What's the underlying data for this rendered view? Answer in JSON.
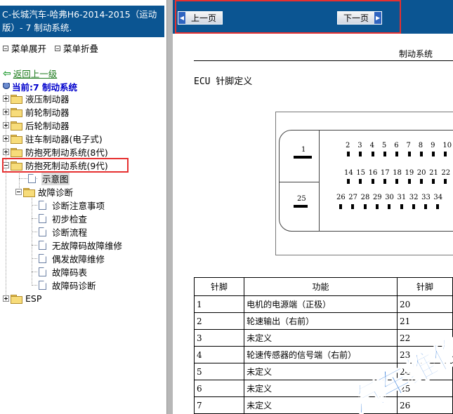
{
  "left_panel": {
    "title": "C-长城汽车-哈弗H6-2014-2015（运动版）- 7 制动系统.",
    "expand_all": "菜单展开",
    "collapse_all": "菜单折叠",
    "back_link": "返回上一级",
    "current": "当前:7 制动系统",
    "tree": [
      {
        "label": "液压制动器",
        "expanded": false
      },
      {
        "label": "前轮制动器",
        "expanded": false
      },
      {
        "label": "后轮制动器",
        "expanded": false
      },
      {
        "label": "驻车制动器(电子式)",
        "expanded": false
      },
      {
        "label": "防抱死制动系统(8代)",
        "expanded": false
      },
      {
        "label": "防抱死制动系统(9代)",
        "expanded": true
      },
      {
        "label": "示意图",
        "selected": true
      },
      {
        "label": "故障诊断",
        "expanded": true
      },
      {
        "label": "诊断注意事项"
      },
      {
        "label": "初步检查"
      },
      {
        "label": "诊断流程"
      },
      {
        "label": "无故障码故障维修"
      },
      {
        "label": "偶发故障维修"
      },
      {
        "label": "故障码表"
      },
      {
        "label": "故障码诊断"
      },
      {
        "label": "ESP",
        "expanded": false
      }
    ]
  },
  "nav": {
    "prev_label": "上一页",
    "next_label": "下一页"
  },
  "document": {
    "section_title": "制动系统",
    "heading": "ECU 针脚定义",
    "connector": {
      "left_pins": [
        "1",
        "25"
      ],
      "row1": [
        "2",
        "3",
        "4",
        "5",
        "6",
        "7",
        "8",
        "9",
        "10"
      ],
      "row2": [
        "14",
        "15",
        "16",
        "17",
        "18",
        "19",
        "20",
        "21",
        "22"
      ],
      "row3": [
        "26",
        "27",
        "28",
        "29",
        "30",
        "31",
        "32",
        "33",
        "34"
      ]
    },
    "table": {
      "headers": [
        "针脚",
        "功能",
        "针脚"
      ],
      "rows": [
        [
          "1",
          "电机的电源端（正极）",
          "20"
        ],
        [
          "2",
          "轮速输出（右前）",
          "21"
        ],
        [
          "3",
          "未定义",
          "22"
        ],
        [
          "4",
          "轮速传感器的信号端（右前）",
          "23"
        ],
        [
          "5",
          "未定义",
          "24"
        ],
        [
          "6",
          "未定义",
          "25"
        ],
        [
          "7",
          "未定义",
          "26"
        ]
      ]
    },
    "watermark_text": "汽车维修"
  },
  "colors": {
    "header_blue": "#0b5592",
    "highlight_red": "#e63030",
    "link_green": "#1b7a1b",
    "current_blue": "#0000cc"
  }
}
